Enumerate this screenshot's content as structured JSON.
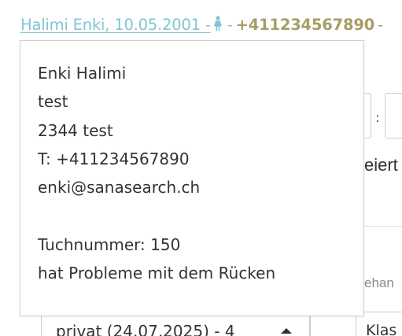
{
  "header": {
    "patient_link": "Halimi Enki, 10.05.2001 -",
    "dash": "-",
    "phone": "+411234567890",
    "trailing": "-",
    "gender_icon": "female-person-icon"
  },
  "popover": {
    "name": "Enki Halimi",
    "address_line": "test",
    "city_line": "2344 test",
    "phone_line": "T: +411234567890",
    "email": "enki@sanasearch.ch",
    "tuchnummer": "Tuchnummer: 150",
    "note": "hat Probleme mit dem Rücken"
  },
  "background": {
    "partial_label_1": "eiert",
    "partial_label_2": "ehan",
    "time_separator": ":",
    "select_value": "privat (24.07.2025) - 4",
    "right_select_value": "Klas"
  },
  "colors": {
    "link": "#7fc6d2",
    "phone": "#a69e66",
    "text": "#333333",
    "border": "#cfcfcf"
  }
}
